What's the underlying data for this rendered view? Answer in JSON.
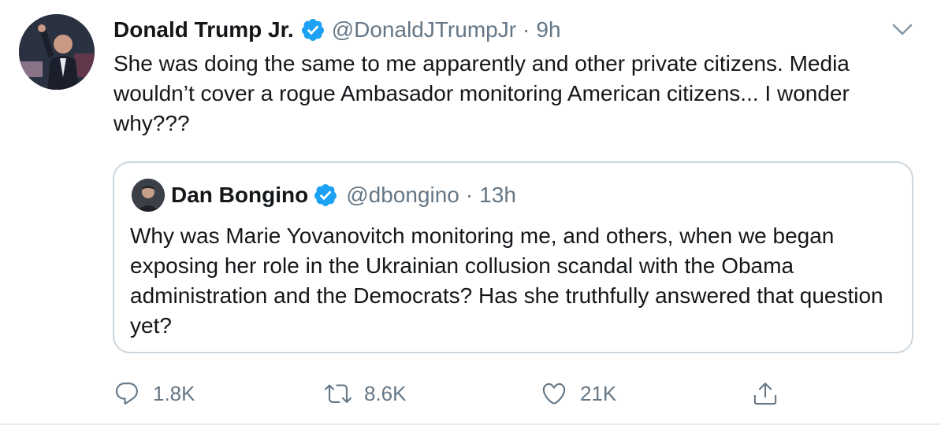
{
  "tweet": {
    "author_name": "Donald Trump Jr.",
    "handle": "@DonaldJTrumpJr",
    "separator": "·",
    "time": "9h",
    "text": "She was doing the same to me apparently and other private citizens. Media wouldn’t cover a rogue Ambasador monitoring American citizens... I wonder why???",
    "avatar_icon": "profile-photo",
    "verified_icon": "verified-badge-icon",
    "menu_icon": "chevron-down-icon"
  },
  "quoted_tweet": {
    "author_name": "Dan Bongino",
    "handle": "@dbongino",
    "separator": "·",
    "time": "13h",
    "text": "Why was Marie Yovanovitch monitoring me, and others, when we began exposing her role in the Ukrainian collusion scandal with the Obama administration and the Democrats? Has she truthfully answered that question yet?"
  },
  "actions": {
    "reply_count": "1.8K",
    "retweet_count": "8.6K",
    "like_count": "21K",
    "reply_icon": "reply-icon",
    "retweet_icon": "retweet-icon",
    "like_icon": "heart-icon",
    "share_icon": "share-icon"
  },
  "colors": {
    "verified_blue": "#1da1f2",
    "secondary_text": "#657786",
    "border": "#ccd6dd"
  }
}
